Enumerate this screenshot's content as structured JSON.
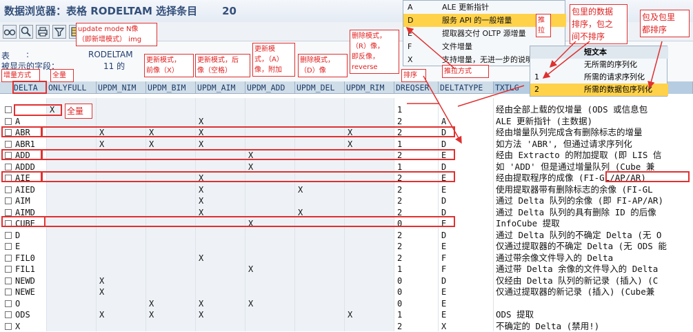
{
  "window": {
    "title": "数据浏览器：表格 RODELTAM 选择条目",
    "count": "20"
  },
  "toolbar": {
    "icons": [
      "glasses-icon",
      "find-icon",
      "print-icon",
      "filter-icon",
      "layout-icon"
    ]
  },
  "info": {
    "table_label": "表",
    "colon1": ":",
    "table_name": "RODELTAM",
    "fields_label": "被显示的字段：",
    "field_count": "11 的"
  },
  "headers": [
    "DELTA",
    "ONLYFULL",
    "UPDM_NIM",
    "UPDM_BIM",
    "UPDM_AIM",
    "UPDM_ADD",
    "UPDM_DEL",
    "UPDM_RIM",
    "DREQSER",
    "DELTATYPE",
    "TXTLG"
  ],
  "rows": [
    {
      "delta": "",
      "onlyfull": "X",
      "nim": "",
      "bim": "",
      "aim": "",
      "add": "",
      "del": "",
      "rim": "",
      "dreqser": "1",
      "deltatype": "",
      "txtlg": "经由全部上载的仅增量 (ODS 或信息包"
    },
    {
      "delta": "A",
      "onlyfull": "",
      "nim": "",
      "bim": "",
      "aim": "X",
      "add": "",
      "del": "",
      "rim": "",
      "dreqser": "2",
      "deltatype": "A",
      "txtlg": "ALE 更新指针 (主数据)"
    },
    {
      "delta": "ABR",
      "onlyfull": "",
      "nim": "X",
      "bim": "X",
      "aim": "X",
      "add": "",
      "del": "",
      "rim": "X",
      "dreqser": "2",
      "deltatype": "D",
      "txtlg": "经由增量队列完成含有删除标志的增量"
    },
    {
      "delta": "ABR1",
      "onlyfull": "",
      "nim": "X",
      "bim": "X",
      "aim": "X",
      "add": "",
      "del": "",
      "rim": "X",
      "dreqser": "1",
      "deltatype": "D",
      "txtlg": "如方法 'ABR', 但通过请求序列化"
    },
    {
      "delta": "ADD",
      "onlyfull": "",
      "nim": "",
      "bim": "",
      "aim": "",
      "add": "X",
      "del": "",
      "rim": "",
      "dreqser": "2",
      "deltatype": "E",
      "txtlg": "经由 Extracto 的附加提取 (即 LIS 信"
    },
    {
      "delta": "ADDD",
      "onlyfull": "",
      "nim": "",
      "bim": "",
      "aim": "",
      "add": "X",
      "del": "",
      "rim": "",
      "dreqser": "1",
      "deltatype": "D",
      "txtlg": "如 'ADD' 但是通过增量队列 (Cube 兼"
    },
    {
      "delta": "AIE",
      "onlyfull": "",
      "nim": "",
      "bim": "",
      "aim": "X",
      "add": "",
      "del": "",
      "rim": "",
      "dreqser": "2",
      "deltatype": "E",
      "txtlg": "经由提取程序的成像 (FI-GL/AP/AR)"
    },
    {
      "delta": "AIED",
      "onlyfull": "",
      "nim": "",
      "bim": "",
      "aim": "X",
      "add": "",
      "del": "X",
      "rim": "",
      "dreqser": "2",
      "deltatype": "E",
      "txtlg": "使用提取器带有删除标志的余像 (FI-GL"
    },
    {
      "delta": "AIM",
      "onlyfull": "",
      "nim": "",
      "bim": "",
      "aim": "X",
      "add": "",
      "del": "",
      "rim": "",
      "dreqser": "2",
      "deltatype": "D",
      "txtlg": "通过 Delta 队列的余像 (即 FI-AP/AR)"
    },
    {
      "delta": "AIMD",
      "onlyfull": "",
      "nim": "",
      "bim": "",
      "aim": "X",
      "add": "",
      "del": "X",
      "rim": "",
      "dreqser": "2",
      "deltatype": "D",
      "txtlg": "通过 Delta 队列的具有删除 ID 的后像"
    },
    {
      "delta": "CUBE",
      "onlyfull": "",
      "nim": "",
      "bim": "",
      "aim": "",
      "add": "X",
      "del": "",
      "rim": "",
      "dreqser": "0",
      "deltatype": "E",
      "txtlg": "InfoCube 提取"
    },
    {
      "delta": "D",
      "onlyfull": "",
      "nim": "",
      "bim": "",
      "aim": "",
      "add": "",
      "del": "",
      "rim": "",
      "dreqser": "2",
      "deltatype": "D",
      "txtlg": "通过 Delta 队列的不确定 Delta (无 O"
    },
    {
      "delta": "E",
      "onlyfull": "",
      "nim": "",
      "bim": "",
      "aim": "",
      "add": "",
      "del": "",
      "rim": "",
      "dreqser": "2",
      "deltatype": "E",
      "txtlg": "仅通过提取器的不确定 Delta (无 ODS 能"
    },
    {
      "delta": "FIL0",
      "onlyfull": "",
      "nim": "",
      "bim": "",
      "aim": "X",
      "add": "",
      "del": "",
      "rim": "",
      "dreqser": "2",
      "deltatype": "F",
      "txtlg": "通过带余像文件导入的 Delta"
    },
    {
      "delta": "FIL1",
      "onlyfull": "",
      "nim": "",
      "bim": "",
      "aim": "",
      "add": "X",
      "del": "",
      "rim": "",
      "dreqser": "1",
      "deltatype": "F",
      "txtlg": "通过带 Delta 余像的文件导入的 Delta"
    },
    {
      "delta": "NEWD",
      "onlyfull": "",
      "nim": "X",
      "bim": "",
      "aim": "",
      "add": "",
      "del": "",
      "rim": "",
      "dreqser": "0",
      "deltatype": "D",
      "txtlg": "仅经由 Delta 队列的新记录 (插入) (C"
    },
    {
      "delta": "NEWE",
      "onlyfull": "",
      "nim": "X",
      "bim": "",
      "aim": "",
      "add": "",
      "del": "",
      "rim": "",
      "dreqser": "0",
      "deltatype": "E",
      "txtlg": "仅通过提取器的新记录 (插入) (Cube兼"
    },
    {
      "delta": "O",
      "onlyfull": "",
      "nim": "",
      "bim": "X",
      "aim": "X",
      "add": "X",
      "del": "",
      "rim": "",
      "dreqser": "0",
      "deltatype": "E",
      "txtlg": ""
    },
    {
      "delta": "ODS",
      "onlyfull": "",
      "nim": "X",
      "bim": "X",
      "aim": "X",
      "add": "",
      "del": "",
      "rim": "X",
      "dreqser": "1",
      "deltatype": "E",
      "txtlg": "ODS 提取"
    },
    {
      "delta": "X",
      "onlyfull": "",
      "nim": "",
      "bim": "",
      "aim": "",
      "add": "",
      "del": "",
      "rim": "",
      "dreqser": "2",
      "deltatype": "X",
      "txtlg": "不确定的 Delta (禁用!)"
    }
  ],
  "deltatype_dropdown": [
    {
      "key": "A",
      "value": "ALE 更新指针"
    },
    {
      "key": "D",
      "value": "服务 API 的一般增量"
    },
    {
      "key": "E",
      "value": "提取器交付 OLTP 源增量"
    },
    {
      "key": "F",
      "value": "文件增量"
    },
    {
      "key": "X",
      "value": "支持增量，无进一步的说明 ( 过时"
    }
  ],
  "dreqser_dropdown": {
    "header_label": "短文本",
    "items": [
      {
        "key": "",
        "value": "无所需的序列化"
      },
      {
        "key": "1",
        "value": "所需的请求序列化"
      },
      {
        "key": "2",
        "value": "所需的数据包序列化"
      }
    ]
  },
  "annotations": {
    "update_mode_n": "update mode N像\n（即新增模式） img",
    "delete_mode_r": "删除模式，\n（R）像，\n即反像，\nreverse",
    "incremental_mode": "增量方式",
    "full": "全量",
    "full_marker": "全量",
    "update_before": "更新模式，\n前像（X）",
    "update_after": "更新模式，后\n像（空格）",
    "update_add": "更新模\n式，（A）\n像，附加",
    "delete_d": "删除模式，\n（D）像",
    "sort": "排序",
    "pull": "推\n拉",
    "push_pull_mode": "推拉方式",
    "package_sort": "包里的数据\n排序，包之\n间不排序",
    "package_all_sort": "包及包里\n都排序"
  },
  "colors": {
    "accent": "#e03030",
    "header": "#cfdde9",
    "selected": "#ffd24a",
    "title": "#34507a"
  }
}
